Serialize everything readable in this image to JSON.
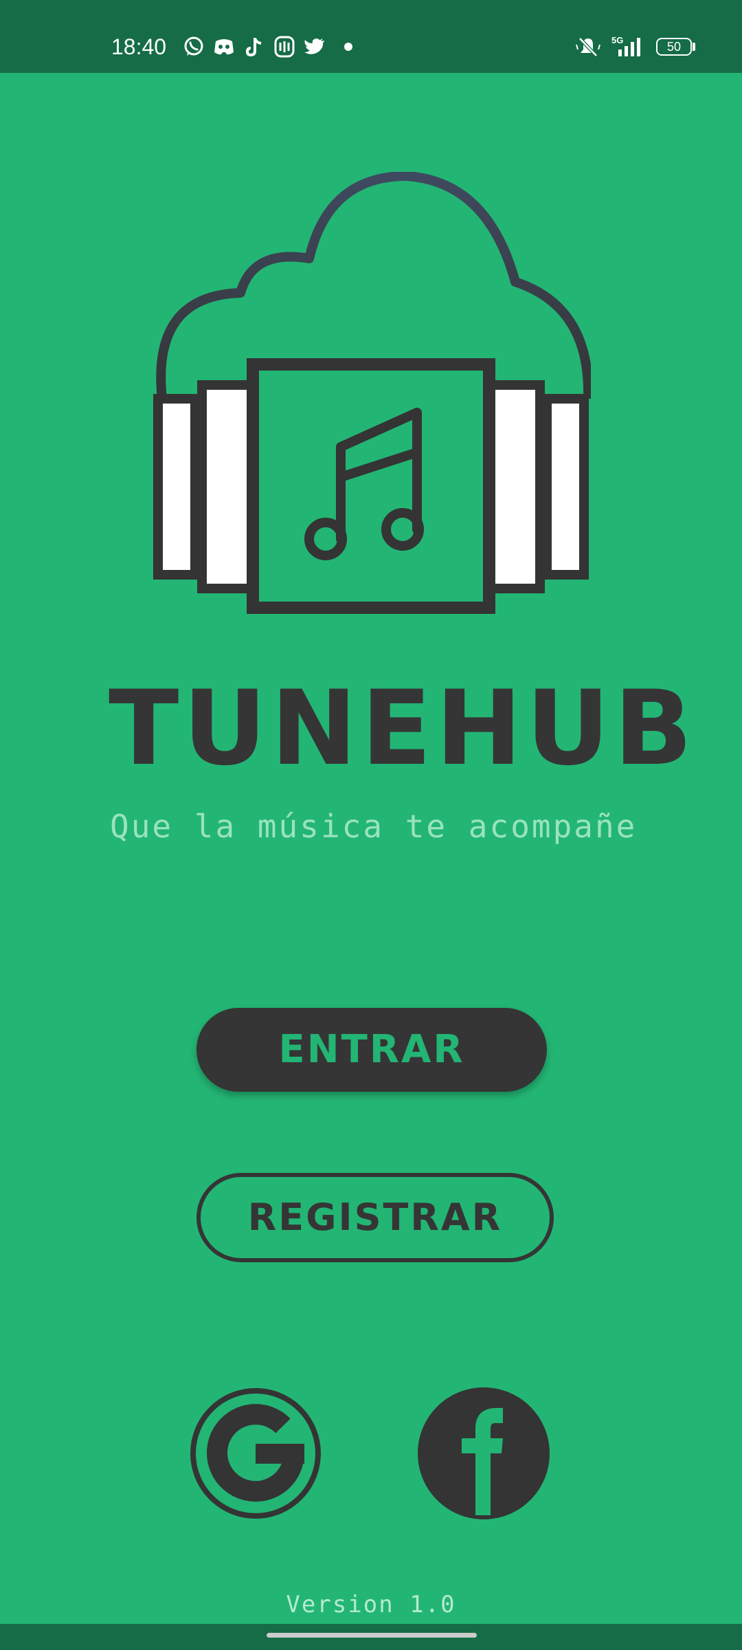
{
  "status_bar": {
    "time": "18:40",
    "battery": "50",
    "icons": [
      "whatsapp-icon",
      "discord-icon",
      "tiktok-icon",
      "app-icon",
      "twitter-icon",
      "notification-dot",
      "mute-icon",
      "5g-icon",
      "signal-icon",
      "battery-icon"
    ]
  },
  "app": {
    "title": "TUNEHUB",
    "tagline": "Que la música te acompañe",
    "logo": "cloud-headphones-music-note-icon"
  },
  "buttons": {
    "enter": "ENTRAR",
    "register": "REGISTRAR"
  },
  "social": {
    "google": "google-icon",
    "facebook": "facebook-icon"
  },
  "footer": {
    "version": "Version 1.0"
  },
  "colors": {
    "background": "#23b574",
    "status_bar": "#156c47",
    "dark": "#353535",
    "tagline": "#9ae3bf"
  }
}
